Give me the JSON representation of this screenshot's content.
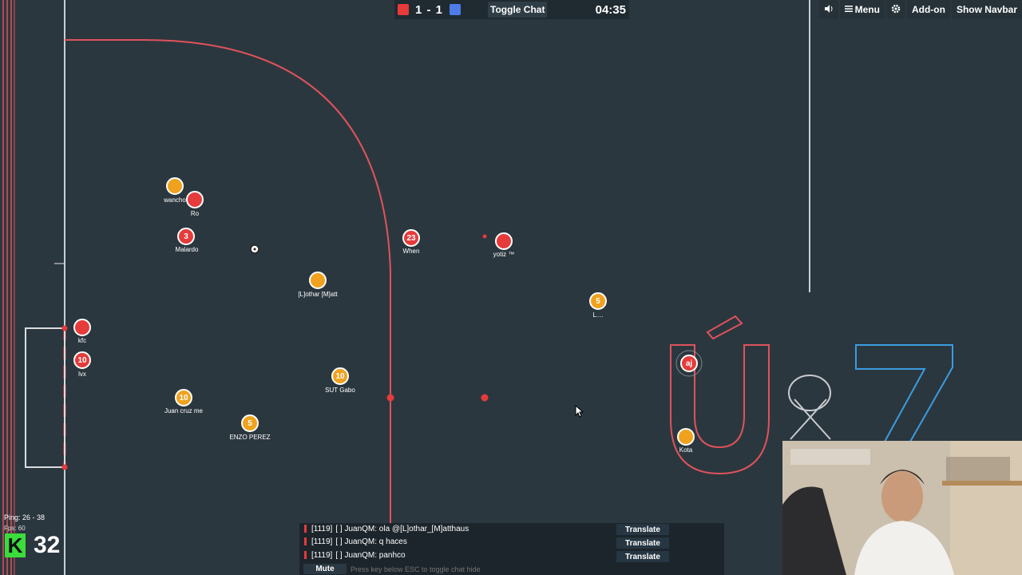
{
  "scoreboard": {
    "red_color": "#e53b3b",
    "blue_color": "#4d7ce8",
    "score": "1 - 1",
    "toggle_chat_label": "Toggle Chat",
    "timer": "04:35"
  },
  "navbar": {
    "sound_icon": "speaker-icon",
    "menu_label": "Menu",
    "settings_icon": "gear-icon",
    "addon_label": "Add-on",
    "show_navbar_label": "Show Navbar"
  },
  "players": [
    {
      "team": "orange",
      "number": "",
      "name": "wancho"
    },
    {
      "team": "red",
      "number": "",
      "name": "Ro"
    },
    {
      "team": "red",
      "number": "3",
      "name": "Malardo"
    },
    {
      "team": "orange",
      "number": "",
      "name": "[L]othar [M]att"
    },
    {
      "team": "red",
      "number": "23",
      "name": "When"
    },
    {
      "team": "red",
      "number": "",
      "name": "yotiz ™"
    },
    {
      "team": "orange",
      "number": "5",
      "name": "L...."
    },
    {
      "team": "red",
      "number": "",
      "name": "kfc"
    },
    {
      "team": "red",
      "number": "10",
      "name": "lvx"
    },
    {
      "team": "orange",
      "number": "10",
      "name": "SUT Gabo"
    },
    {
      "team": "orange",
      "number": "10",
      "name": "Juan cruz me"
    },
    {
      "team": "orange",
      "number": "5",
      "name": "ENZO PEREZ"
    },
    {
      "team": "red",
      "number": "aj",
      "name": ""
    },
    {
      "team": "orange",
      "number": "",
      "name": "Kota"
    }
  ],
  "hud": {
    "ping": "Ping: 26 - 38",
    "fps": "Fps: 60",
    "logo_letter": "K",
    "logo_number": "32"
  },
  "chat": {
    "messages": [
      {
        "id": "[1119]",
        "text": "[ ] JuanQM: ola @[L]othar_[M]atthaus"
      },
      {
        "id": "[1119]",
        "text": "[ ] JuanQM: q haces"
      },
      {
        "id": "[1119]",
        "text": "[ ] JuanQM: panhco"
      }
    ],
    "translate_label": "Translate",
    "mute_label": "Mute",
    "input_placeholder": "Press key below ESC to toggle chat hide"
  }
}
